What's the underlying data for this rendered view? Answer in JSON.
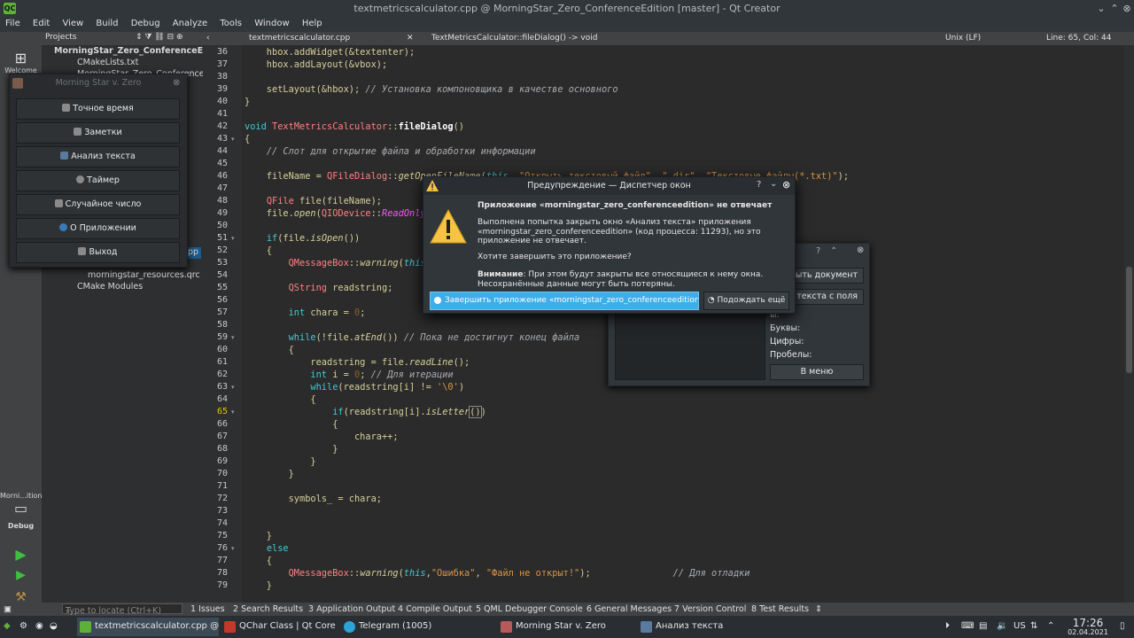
{
  "window": {
    "title": "textmetricscalculator.cpp @ MorningStar_Zero_ConferenceEdition [master] - Qt Creator"
  },
  "menu": [
    "File",
    "Edit",
    "View",
    "Build",
    "Debug",
    "Analyze",
    "Tools",
    "Window",
    "Help"
  ],
  "modes": {
    "welcome": "Welcome",
    "kit_label": "Morni...ition",
    "debug": "Debug"
  },
  "projects": {
    "header": "Projects",
    "items": [
      "MorningStar_Zero_ConferenceE",
      "CMakeLists.txt",
      "MorningStar_Zero_ConferenceEd",
      "pp",
      "morningstar_resources.qrc",
      "CMake Modules"
    ]
  },
  "editor": {
    "file": "textmetricscalculator.cpp",
    "function": "TextMetricsCalculator::fileDialog() -> void",
    "encoding": "Unix (LF)",
    "position": "Line: 65, Col: 44"
  },
  "code_lines": [
    "36",
    "37",
    "38",
    "39",
    "40",
    "41",
    "42",
    "43",
    "44",
    "45",
    "46",
    "47",
    "48",
    "49",
    "50",
    "51",
    "52",
    "53",
    "54",
    "55",
    "56",
    "57",
    "58",
    "59",
    "60",
    "61",
    "62",
    "63",
    "64",
    "65",
    "66",
    "67",
    "68",
    "69",
    "70",
    "71",
    "72",
    "73",
    "74",
    "75",
    "76",
    "77",
    "78",
    "79"
  ],
  "menu_window": {
    "title": "Morning Star v. Zero",
    "buttons": [
      "Точное время",
      "Заметки",
      "Анализ текста",
      "Таймер",
      "Случайное число",
      "О Приложении",
      "Выход"
    ]
  },
  "text_window": {
    "buttons": [
      "рыть документ",
      "з текста с поля",
      "В меню"
    ],
    "labels": [
      "Буквы:",
      "Цифры:",
      "Пробелы:"
    ],
    "partial": "ы:"
  },
  "dialog": {
    "title": "Предупреждение — Диспетчер окон",
    "heading": "Приложение «morningstar_zero_conferenceedition» не отвечает",
    "body1": "Выполнена попытка закрыть окно «Анализ текста» приложения «morningstar_zero_conferenceedition» (код процесса: 11293), но это приложение не отвечает.",
    "body2": "Хотите завершить это приложение?",
    "note_label": "Внимание",
    "note": ": При этом будут закрыты все относящиеся к нему окна. Несохранённые данные могут быть потеряны.",
    "button_terminate": "Завершить приложение «morningstar_zero_conferenceedition»",
    "button_wait": "Подождать ещё"
  },
  "statusbar": {
    "locate_placeholder": "Type to locate (Ctrl+K)",
    "tabs": [
      "1 Issues",
      "2 Search Results",
      "3 Application Output",
      "4 Compile Output",
      "5 QML Debugger Console",
      "6 General Messages",
      "7 Version Control",
      "8 Test Results"
    ]
  },
  "taskbar": {
    "tasks": [
      "textmetricscalculator.cpp @ ...",
      "QChar Class | Qt Core 5....",
      "Telegram (1005)",
      "Morning Star v. Zero",
      "Анализ текста"
    ],
    "lang": "US",
    "time": "17:26",
    "date": "02.04.2021"
  },
  "colors": {
    "accent": "#3daee9",
    "keyword": "#45c6d6",
    "type": "#ff8080",
    "string": "#d69545"
  }
}
